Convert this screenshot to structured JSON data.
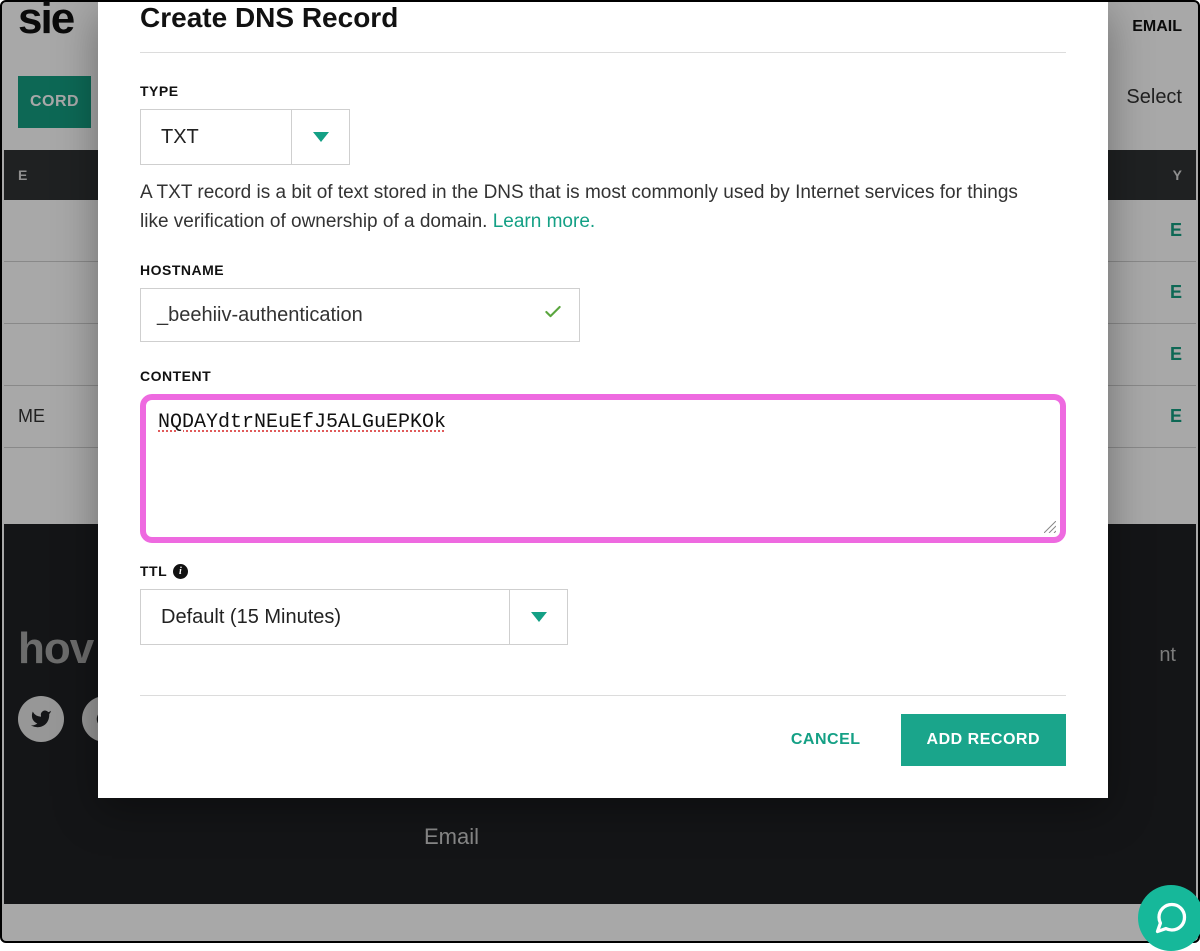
{
  "background": {
    "logo_fragment": "sie",
    "email_label": "EMAIL",
    "add_record": "CORD",
    "select_label": "Select",
    "tab_left": "E",
    "tab_right": "Y",
    "row_me": "ME",
    "row_mark": "E",
    "footer_brand": "hov",
    "footer_nt": "nt",
    "footer_email": "Email"
  },
  "modal": {
    "title": "Create DNS Record",
    "type": {
      "label": "TYPE",
      "value": "TXT",
      "description_a": "A TXT record is a bit of text stored in the DNS that is most commonly used by Internet services for things like verification of ownership of a domain. ",
      "learn_more": "Learn more."
    },
    "hostname": {
      "label": "HOSTNAME",
      "value": "_beehiiv-authentication"
    },
    "content": {
      "label": "CONTENT",
      "value": "NQDAYdtrNEuEfJ5ALGuEPKOk"
    },
    "ttl": {
      "label": "TTL",
      "value": "Default (15 Minutes)"
    },
    "actions": {
      "cancel": "CANCEL",
      "submit": "ADD RECORD"
    }
  }
}
